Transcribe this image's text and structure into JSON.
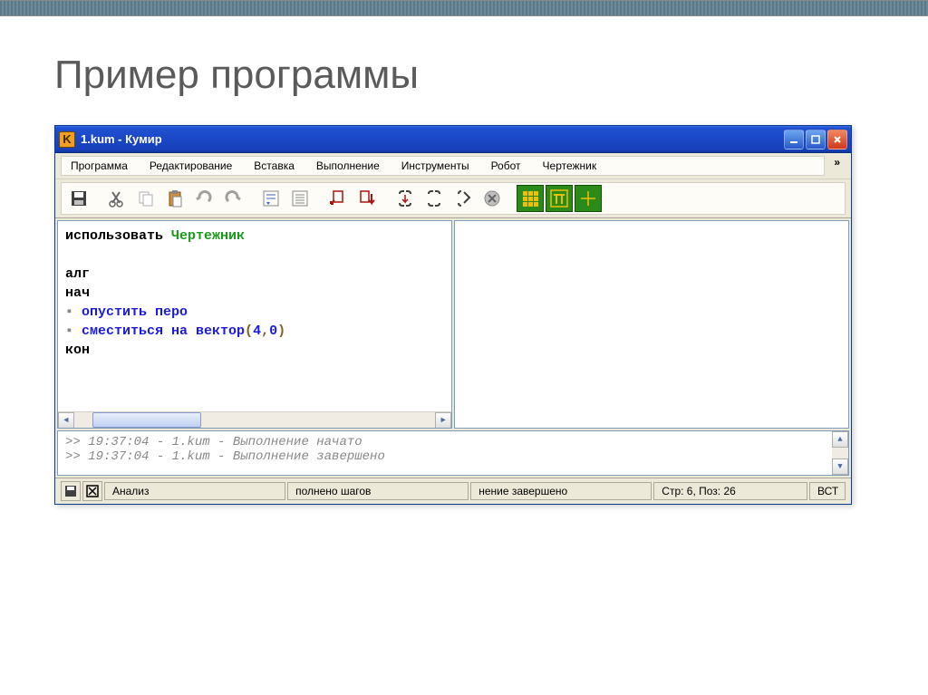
{
  "slide": {
    "title": "Пример программы"
  },
  "window": {
    "title": "1.kum - Кумир",
    "icon_letter": "K"
  },
  "menu": {
    "items": [
      "Программа",
      "Редактирование",
      "Вставка",
      "Выполнение",
      "Инструменты",
      "Робот",
      "Чертежник"
    ],
    "overflow": "»"
  },
  "toolbar": {
    "icons": [
      "save-icon",
      "cut-icon",
      "copy-icon",
      "paste-icon",
      "undo-icon",
      "redo-icon",
      "indent-icon",
      "outdent-icon",
      "run-icon",
      "step-icon",
      "step-into-icon",
      "step-out-icon",
      "goto-icon",
      "stop-icon",
      "grid-icon",
      "pi-icon",
      "axes-icon"
    ]
  },
  "code": {
    "l1a": "использовать ",
    "l1b": "Чертежник",
    "l3": "алг",
    "l4": "нач",
    "l5": "опустить перо",
    "l6a": "сместиться на вектор",
    "l6b": "(",
    "l6c": "4",
    "l6d": ",",
    "l6e": "0",
    "l6f": ")",
    "l7": "кон"
  },
  "console": {
    "line1": ">> 19:37:04 - 1.kum - Выполнение начато",
    "line2": ">> 19:37:04 - 1.kum - Выполнение завершено"
  },
  "status": {
    "analysis": "Анализ",
    "steps": "полнено шагов",
    "done": "нение завершено",
    "pos": "Стр: 6, Поз: 26",
    "mode": "ВСТ"
  }
}
